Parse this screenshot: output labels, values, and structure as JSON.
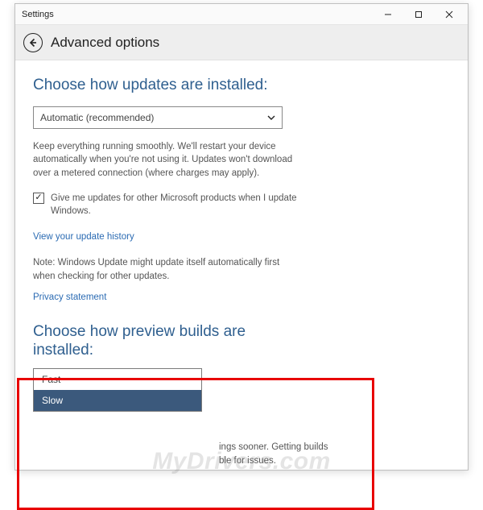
{
  "titlebar": {
    "title": "Settings"
  },
  "header": {
    "title": "Advanced options"
  },
  "updates": {
    "heading": "Choose how updates are installed:",
    "dropdown_value": "Automatic (recommended)",
    "description": "Keep everything running smoothly. We'll restart your device automatically when you're not using it. Updates won't download over a metered connection (where charges may apply).",
    "checkbox_checked": "✓",
    "checkbox_label": "Give me updates for other Microsoft products when I update Windows.",
    "history_link": "View your update history",
    "note": "Note: Windows Update might update itself automatically first when checking for other updates.",
    "privacy_link": "Privacy statement"
  },
  "preview": {
    "heading": "Choose how preview builds are installed:",
    "fragment": "ings sooner. Getting builds ble for issues.",
    "options": {
      "fast": "Fast",
      "slow": "Slow"
    }
  },
  "watermark": "MyDrivers.com"
}
